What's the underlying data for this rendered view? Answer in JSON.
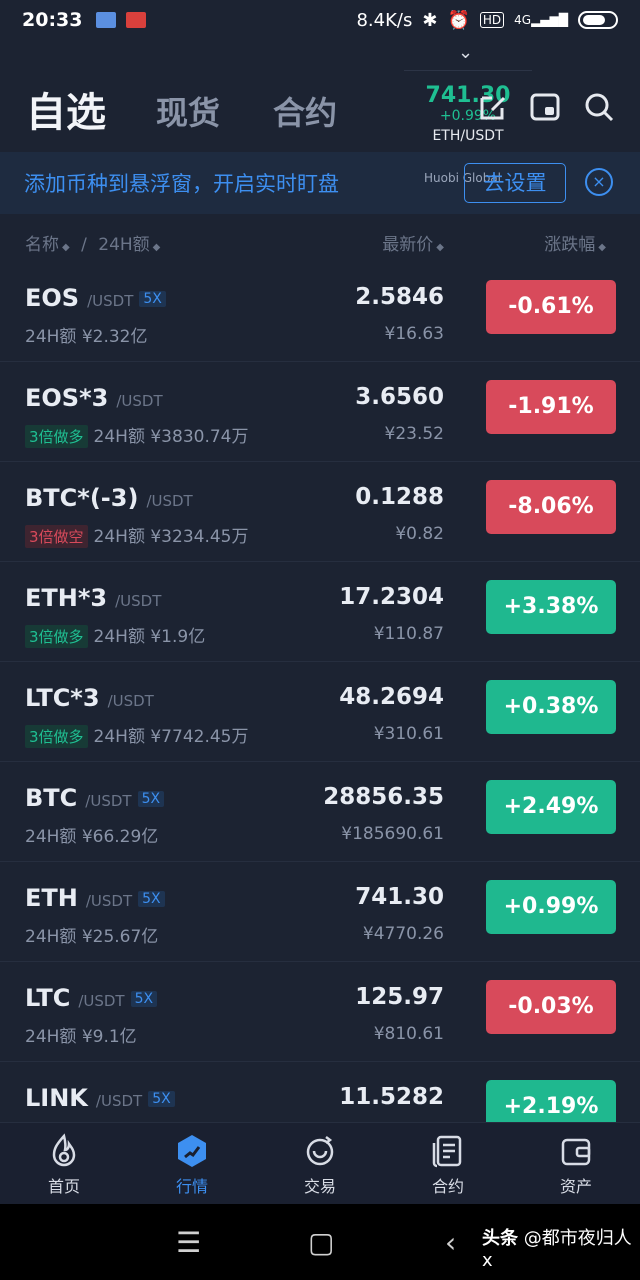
{
  "status": {
    "time": "20:33",
    "net_speed": "8.4K/s",
    "hd": "HD",
    "signal": "4G"
  },
  "header": {
    "tabs": [
      {
        "label": "自选"
      },
      {
        "label": "现货"
      },
      {
        "label": "合约"
      }
    ],
    "float_ticker": {
      "price": "741.30",
      "change": "+0.99%",
      "pair": "ETH/USDT"
    }
  },
  "banner": {
    "text": "添加币种到悬浮窗，开启实时盯盘",
    "brand": "Huobi Global",
    "button_label": "去设置",
    "close_symbol": "×"
  },
  "columns": {
    "name": "名称",
    "separator": "/",
    "volume": "24H额",
    "price": "最新价",
    "change": "涨跌幅"
  },
  "rows": [
    {
      "symbol": "EOS",
      "quote": "/USDT",
      "lev": "5X",
      "tag": "",
      "volume": "24H额 ¥2.32亿",
      "price": "2.5846",
      "cny": "¥16.63",
      "change": "-0.61%",
      "dir": "down"
    },
    {
      "symbol": "EOS*3",
      "quote": "/USDT",
      "lev": "",
      "tag": "3倍做多",
      "volume": "24H额 ¥3830.74万",
      "price": "3.6560",
      "cny": "¥23.52",
      "change": "-1.91%",
      "dir": "down"
    },
    {
      "symbol": "BTC*(-3)",
      "quote": "/USDT",
      "lev": "",
      "tag": "3倍做空",
      "volume": "24H额 ¥3234.45万",
      "price": "0.1288",
      "cny": "¥0.82",
      "change": "-8.06%",
      "dir": "down"
    },
    {
      "symbol": "ETH*3",
      "quote": "/USDT",
      "lev": "",
      "tag": "3倍做多",
      "volume": "24H额 ¥1.9亿",
      "price": "17.2304",
      "cny": "¥110.87",
      "change": "+3.38%",
      "dir": "up"
    },
    {
      "symbol": "LTC*3",
      "quote": "/USDT",
      "lev": "",
      "tag": "3倍做多",
      "volume": "24H额 ¥7742.45万",
      "price": "48.2694",
      "cny": "¥310.61",
      "change": "+0.38%",
      "dir": "up"
    },
    {
      "symbol": "BTC",
      "quote": "/USDT",
      "lev": "5X",
      "tag": "",
      "volume": "24H额 ¥66.29亿",
      "price": "28856.35",
      "cny": "¥185690.61",
      "change": "+2.49%",
      "dir": "up"
    },
    {
      "symbol": "ETH",
      "quote": "/USDT",
      "lev": "5X",
      "tag": "",
      "volume": "24H额 ¥25.67亿",
      "price": "741.30",
      "cny": "¥4770.26",
      "change": "+0.99%",
      "dir": "up"
    },
    {
      "symbol": "LTC",
      "quote": "/USDT",
      "lev": "5X",
      "tag": "",
      "volume": "24H额 ¥9.1亿",
      "price": "125.97",
      "cny": "¥810.61",
      "change": "-0.03%",
      "dir": "down"
    },
    {
      "symbol": "LINK",
      "quote": "/USDT",
      "lev": "5X",
      "tag": "",
      "volume": "",
      "price": "11.5282",
      "cny": "",
      "change": "+2.19%",
      "dir": "up"
    }
  ],
  "bottom_nav": [
    {
      "label": "首页",
      "icon": "flame-icon"
    },
    {
      "label": "行情",
      "icon": "market-icon",
      "active": true
    },
    {
      "label": "交易",
      "icon": "trade-icon"
    },
    {
      "label": "合约",
      "icon": "contract-icon"
    },
    {
      "label": "资产",
      "icon": "wallet-icon"
    }
  ],
  "watermark": {
    "prefix": "头条",
    "text": "@都市夜归人x"
  },
  "colors": {
    "up": "#1fb88f",
    "down": "#d84a5b",
    "accent": "#3d8ff0",
    "bg": "#1c2332"
  }
}
